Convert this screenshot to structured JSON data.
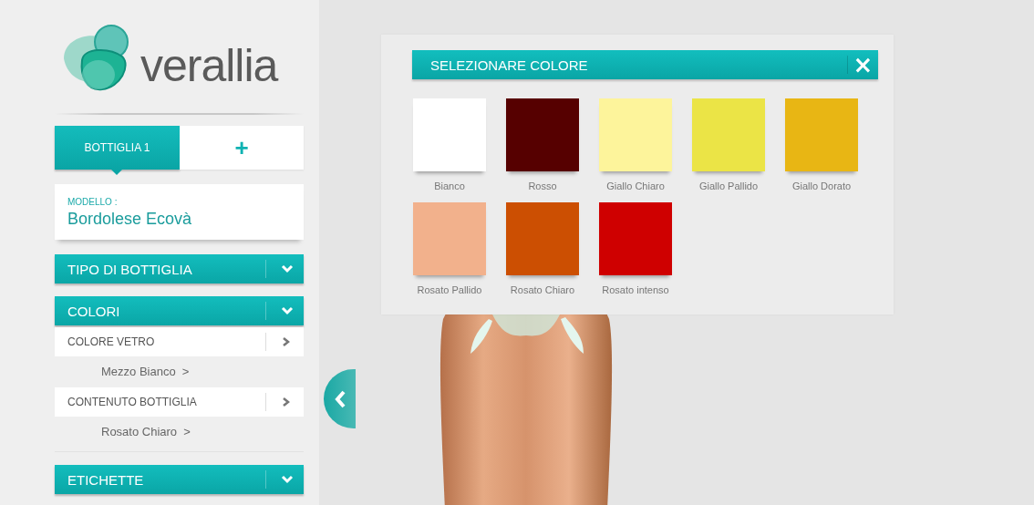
{
  "logo": {
    "text": "verallia"
  },
  "bottle_tabs": [
    {
      "label": "BOTTIGLIA 1",
      "selected": true,
      "kind": "text"
    },
    {
      "label": "+",
      "selected": false,
      "kind": "add"
    }
  ],
  "model": {
    "label": "MODELLO :",
    "value": "Bordolese Ecovà"
  },
  "sections": [
    {
      "title": "TIPO DI BOTTIGLIA"
    },
    {
      "title": "COLORI",
      "items": [
        {
          "label": "COLORE VETRO",
          "value": "Mezzo Bianco  >"
        },
        {
          "label": "CONTENUTO BOTTIGLIA",
          "value": "Rosato Chiaro  >"
        }
      ]
    },
    {
      "title": "ETICHETTE"
    }
  ],
  "dialog": {
    "title": "SELEZIONARE COLORE",
    "close": "×",
    "swatches": [
      {
        "name": "Bianco",
        "color": "#ffffff"
      },
      {
        "name": "Rosso",
        "color": "#560000"
      },
      {
        "name": "Giallo Chiaro",
        "color": "#fdf49b"
      },
      {
        "name": "Giallo Pallido",
        "color": "#ebe446"
      },
      {
        "name": "Giallo Dorato",
        "color": "#e8b614"
      },
      {
        "name": "Rosato Pallido",
        "color": "#f2b18c"
      },
      {
        "name": "Rosato Chiaro",
        "color": "#cc4f02"
      },
      {
        "name": "Rosato intenso",
        "color": "#cf0000"
      }
    ]
  }
}
